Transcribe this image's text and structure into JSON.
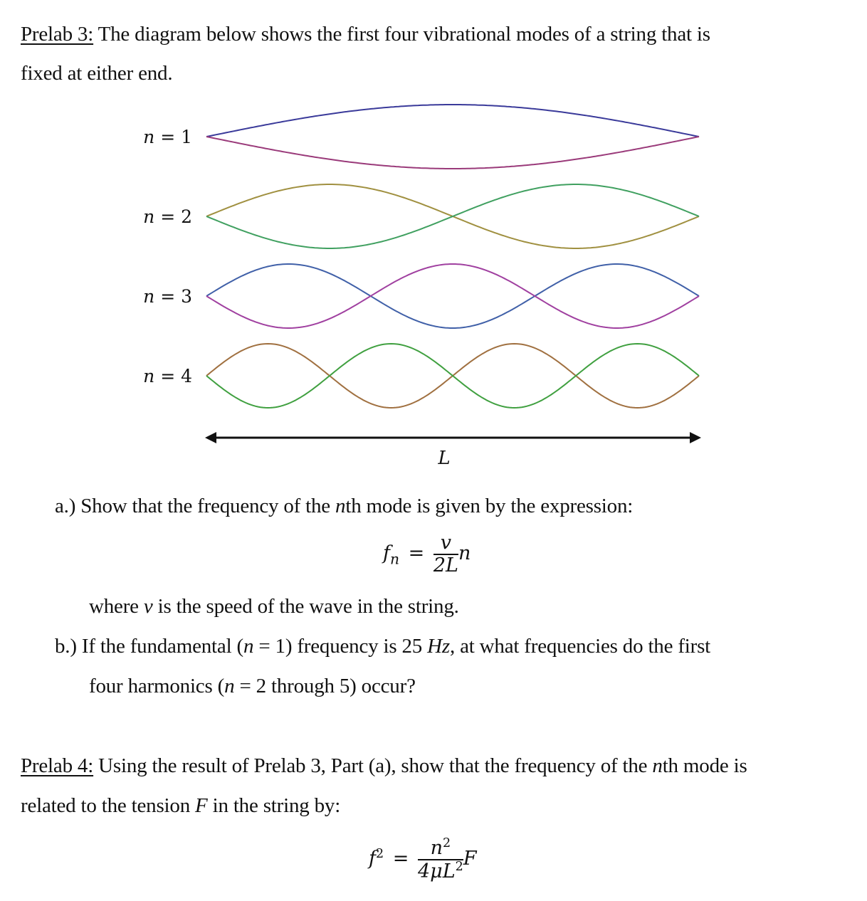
{
  "prelab3": {
    "heading": "Prelab 3:",
    "intro_line1": " The diagram below shows the first four vibrational modes of a string that is",
    "intro_line2": "fixed at either end."
  },
  "diagram": {
    "modes": [
      {
        "label": "n = 1",
        "n": 1,
        "colors": [
          "#3a3a9a",
          "#9a3a7a"
        ]
      },
      {
        "label": "n = 2",
        "n": 2,
        "colors": [
          "#a09040",
          "#40a060"
        ]
      },
      {
        "label": "n = 3",
        "n": 3,
        "colors": [
          "#4060a8",
          "#a040a0"
        ]
      },
      {
        "label": "n = 4",
        "n": 4,
        "colors": [
          "#a07040",
          "#40a040"
        ]
      }
    ],
    "length_label": "L"
  },
  "part_a": {
    "prefix": "a.) Show that the frequency of the ",
    "var": "n",
    "suffix": "th mode is given by the expression:",
    "equation": {
      "lhs": "f",
      "lhs_sub": "n",
      "num": "v",
      "den": "2L",
      "tail": "n"
    },
    "where_pre": "where ",
    "where_var": "v",
    "where_post": " is the speed of the wave in the string."
  },
  "part_b": {
    "line1_a": "b.) If the fundamental (",
    "line1_var": "n",
    "line1_b": " = 1) frequency is 25 ",
    "line1_unit": "Hz",
    "line1_c": ", at what frequencies do the first",
    "line2_a": "four harmonics (",
    "line2_var": "n",
    "line2_b": " = 2 through 5) occur?"
  },
  "prelab4": {
    "heading": "Prelab 4:",
    "line1_a": " Using the result of Prelab 3, Part (a), show that the frequency of the ",
    "line1_var": "n",
    "line1_b": "th mode is",
    "line2_a": "related to the tension ",
    "line2_var": "F",
    "line2_b": " in the string by:",
    "equation": {
      "lhs": "f",
      "lhs_sup": "2",
      "num": "n",
      "num_sup": "2",
      "den": "4μL",
      "den_sup": "2",
      "tail": "F"
    }
  }
}
